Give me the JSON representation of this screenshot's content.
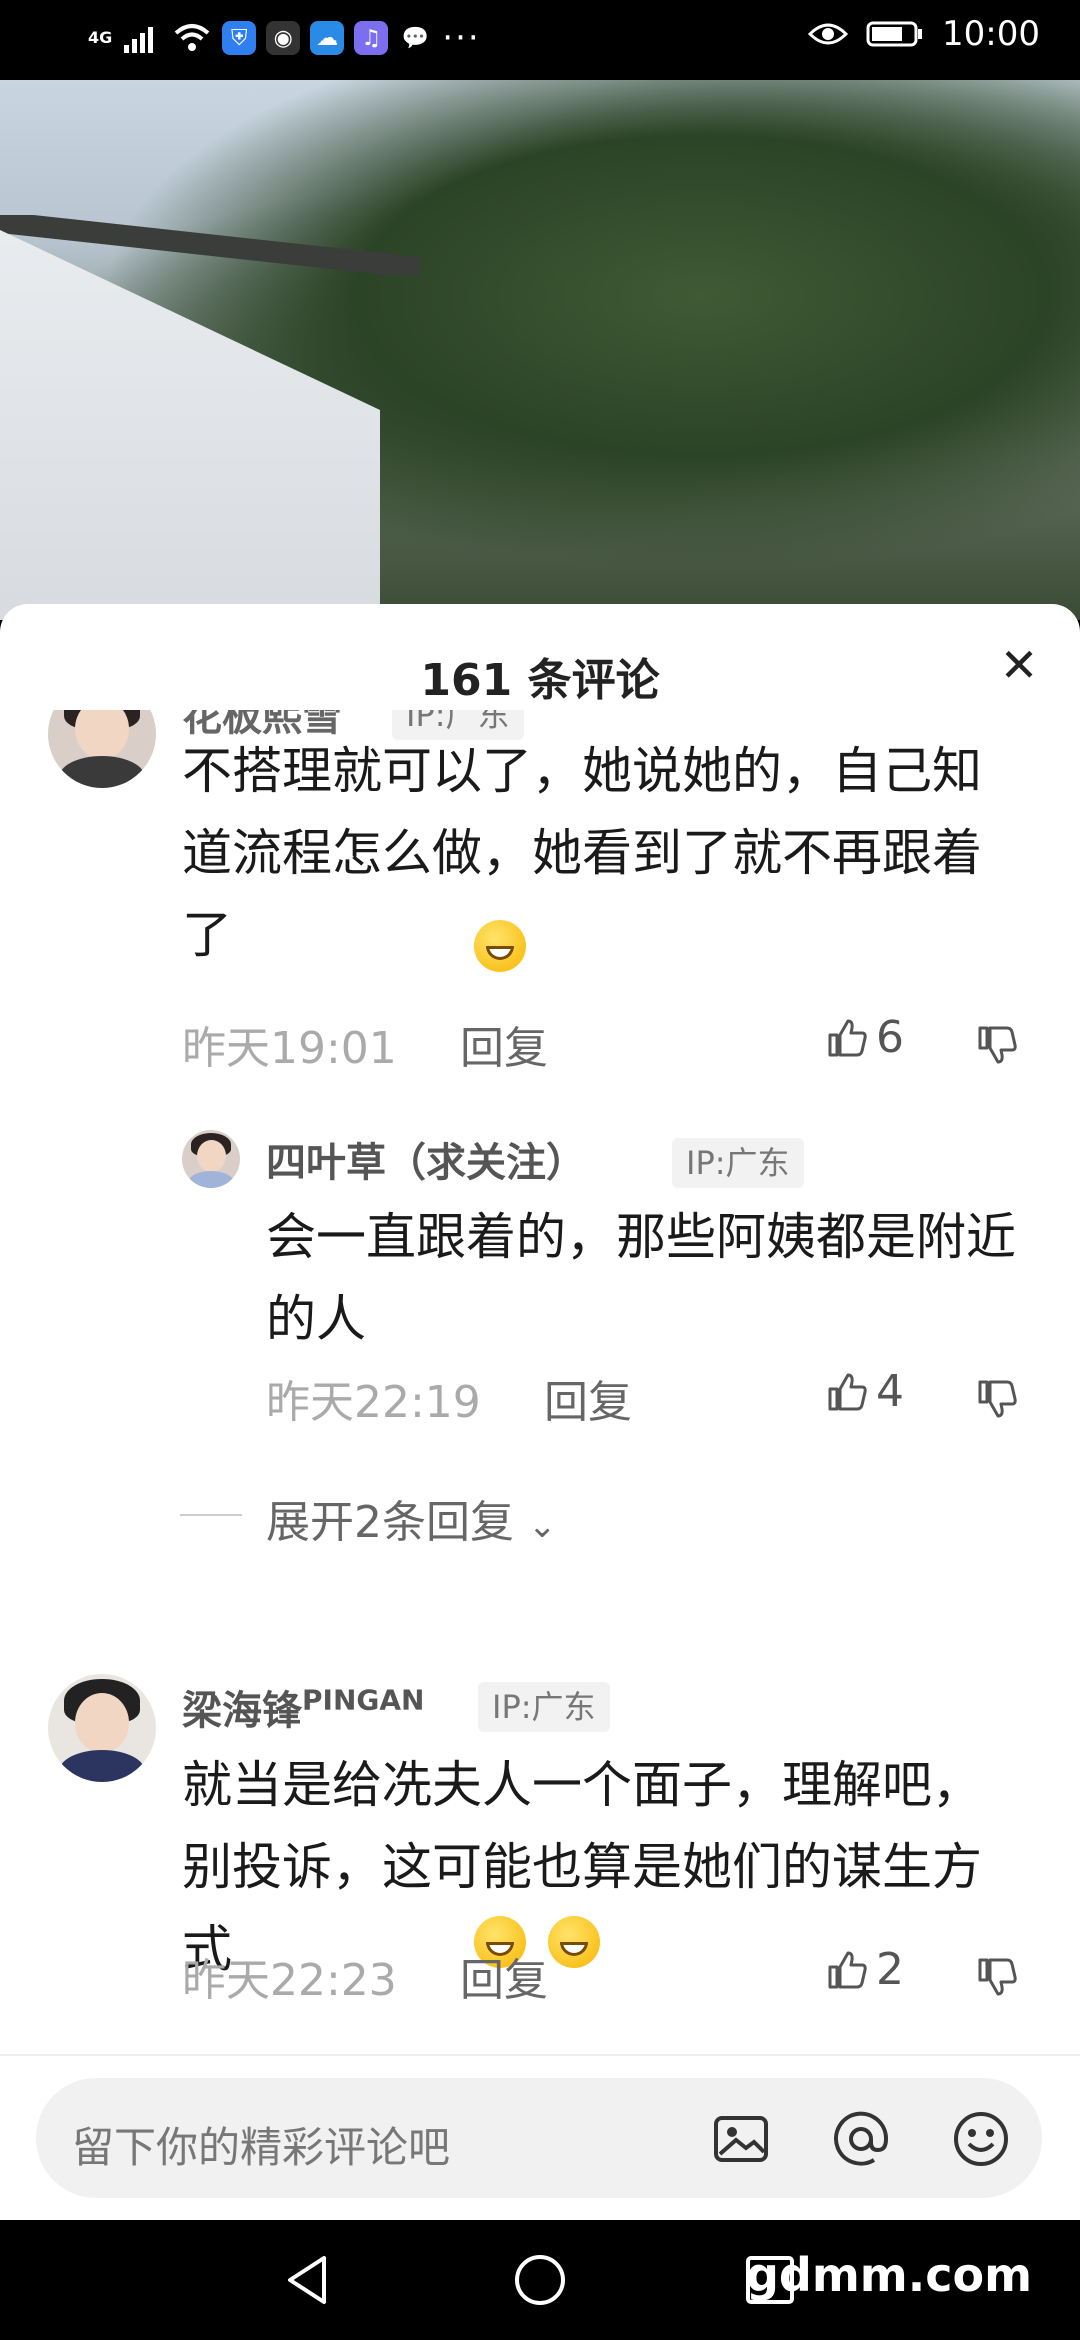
{
  "status_bar": {
    "network": "4G",
    "time": "10:00"
  },
  "sheet": {
    "title": "161 条评论"
  },
  "comments": [
    {
      "name": "花板熙雪",
      "ip": "IP:广东",
      "text": "不搭理就可以了，她说她的，自己知道流程怎么做，她看到了就不再跟着了",
      "time": "昨天19:01",
      "reply_label": "回复",
      "likes": "6"
    },
    {
      "name": "梁海锋",
      "name_sup": "PINGAN",
      "ip": "IP:广东",
      "text": "就当是给冼夫人一个面子，理解吧，别投诉，这可能也算是她们的谋生方式",
      "time": "昨天22:23",
      "reply_label": "回复",
      "likes": "2"
    }
  ],
  "reply": {
    "name": "四叶草（求关注）",
    "ip": "IP:广东",
    "text": "会一直跟着的，那些阿姨都是附近的人",
    "time": "昨天22:19",
    "reply_label": "回复",
    "likes": "4"
  },
  "expand_label": "展开2条回复",
  "input": {
    "placeholder": "留下你的精彩评论吧"
  },
  "watermark": "gdmm.com",
  "icons": [
    "signal-icon",
    "wifi-icon",
    "shield-icon",
    "close-icon",
    "thumb-up-icon",
    "thumb-down-icon",
    "image-icon",
    "at-icon",
    "emoji-icon",
    "back-icon",
    "home-icon",
    "recent-icon"
  ]
}
